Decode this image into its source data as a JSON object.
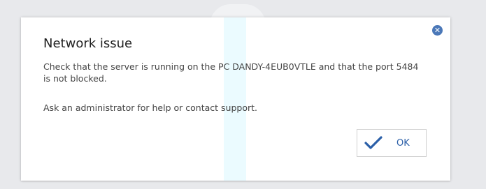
{
  "dialog": {
    "title": "Network issue",
    "message": "Check that the server is running on the PC DANDY-4EUB0VTLE and that the port 5484 is not blocked.",
    "support_text": "Ask an administrator for help or contact support.",
    "close_icon": "close-icon",
    "close_glyph": "✕",
    "ok_button": {
      "label": "OK",
      "icon": "checkmark-icon"
    }
  },
  "colors": {
    "accent": "#2b5fa8",
    "close_button": "#4b78b8",
    "background": "#e8e9ec",
    "dialog": "#ffffff"
  }
}
